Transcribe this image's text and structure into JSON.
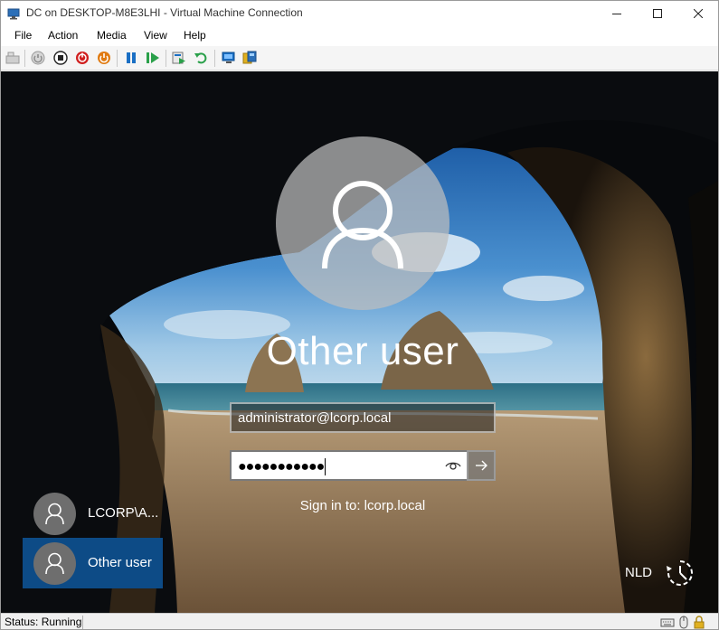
{
  "window": {
    "title": "DC on DESKTOP-M8E3LHI - Virtual Machine Connection",
    "app_icon": "vm-connection-icon",
    "controls": [
      "minimize-icon",
      "maximize-icon",
      "close-icon"
    ]
  },
  "menu": {
    "items": [
      {
        "label": "File"
      },
      {
        "label": "Action"
      },
      {
        "label": "Media"
      },
      {
        "label": "View"
      },
      {
        "label": "Help"
      }
    ]
  },
  "toolbar": {
    "buttons": [
      {
        "name": "ctrl-alt-del-icon",
        "color": "#9a9a9a"
      },
      {
        "name": "start-icon",
        "color": "#9a9a9a"
      },
      {
        "name": "turn-off-icon",
        "color": "#222222"
      },
      {
        "name": "shut-down-icon",
        "color": "#d01f1f"
      },
      {
        "name": "save-icon",
        "color": "#e07a10"
      },
      {
        "name": "pause-icon",
        "color": "#1a6fc4"
      },
      {
        "name": "resume-icon",
        "color": "#2aa04a"
      },
      {
        "name": "checkpoint-icon",
        "color": "#2aa04a"
      },
      {
        "name": "revert-icon",
        "color": "#2aa04a"
      },
      {
        "name": "enhanced-session-icon",
        "color": "#1a6fc4"
      },
      {
        "name": "share-icon",
        "color": "#e0b020"
      }
    ]
  },
  "login": {
    "display_user": "Other user",
    "username_value": "administrator@lcorp.local",
    "password_mask": "●●●●●●●●●●●",
    "sign_in_to": "Sign in to: lcorp.local",
    "users": [
      {
        "label": "LCORP\\A...",
        "selected": false
      },
      {
        "label": "Other user",
        "selected": true
      }
    ],
    "language": "NLD",
    "accent_color": "#0d4b86"
  },
  "status": {
    "text": "Status: Running"
  }
}
